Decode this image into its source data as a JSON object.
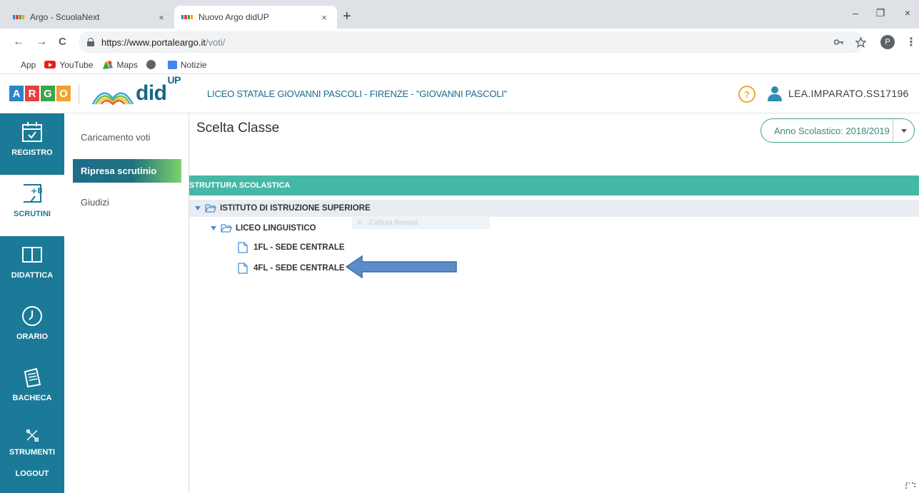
{
  "browser": {
    "tabs": [
      {
        "title": "Argo - ScuolaNext",
        "close": "×"
      },
      {
        "title": "Nuovo Argo didUP",
        "close": "×"
      }
    ],
    "new_tab": "+",
    "window": {
      "minimize": "–",
      "restore": "❐",
      "close": "×"
    },
    "nav": {
      "back": "←",
      "forward": "→",
      "reload": "C"
    },
    "url_host": "https://www.portaleargo.it",
    "url_path": "/voti/",
    "profile_initial": "P",
    "menu": "⋮",
    "bookmarks": [
      "App",
      "YouTube",
      "Maps",
      "",
      "Notizie"
    ]
  },
  "header": {
    "logo_letters": [
      "A",
      "R",
      "G",
      "O"
    ],
    "logo_colors": [
      "#2d85c5",
      "#e8403b",
      "#3aa64b",
      "#f2a22d"
    ],
    "brand": "did",
    "brand_sup": "UP",
    "school": "LICEO STATALE GIOVANNI PASCOLI - FIRENZE - \"GIOVANNI PASCOLI\"",
    "help": "?",
    "user": "LEA.IMPARATO.SS17196"
  },
  "leftnav": [
    {
      "label": "REGISTRO",
      "icon": "calendar-icon",
      "active": false
    },
    {
      "label": "SCRUTINI",
      "icon": "scrutini-icon",
      "active": true
    },
    {
      "label": "DIDATTICA",
      "icon": "book-icon",
      "active": false
    },
    {
      "label": "ORARIO",
      "icon": "clock-icon",
      "active": false
    },
    {
      "label": "BACHECA",
      "icon": "noticeboard-icon",
      "active": false
    },
    {
      "label": "STRUMENTI",
      "icon": "tools-icon",
      "active": false
    },
    {
      "label": "LOGOUT",
      "icon": "",
      "active": false
    }
  ],
  "subnav": [
    {
      "label": "Caricamento voti",
      "active": false
    },
    {
      "label": "Ripresa scrutinio",
      "active": true
    },
    {
      "label": "Giudizi",
      "active": false
    }
  ],
  "content": {
    "title": "Scelta Classe",
    "year_label": "Anno Scolastico: 2018/2019",
    "tree_header": "STRUTTURA SCOLASTICA",
    "tree": {
      "root": "ISTITUTO DI ISTRUZIONE SUPERIORE",
      "branch": "LICEO LINGUISTICO",
      "leaves": [
        "1FL - SEDE CENTRALE",
        "4FL - SEDE CENTRALE"
      ]
    },
    "ghost_tooltip": "Cattura finestra"
  },
  "colors": {
    "nav_bg": "#1a7a97",
    "tree_header": "#46b8a7",
    "accent_green": "#41a28c",
    "arrow_fill": "#5b8ec9"
  }
}
